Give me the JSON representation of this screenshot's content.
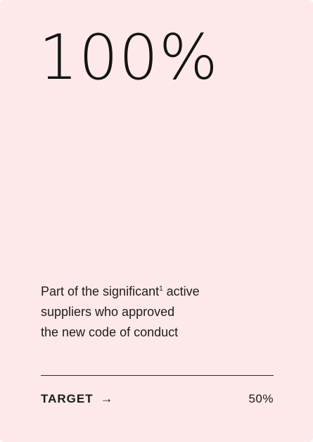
{
  "card": {
    "value": "100%",
    "description": {
      "line1_prefix": "Part of the significant",
      "footnote": "1",
      "line1_suffix": " active",
      "line2": "suppliers who approved",
      "line3": "the new code of conduct"
    },
    "footer": {
      "target_label": "TARGET",
      "arrow_icon": "arrow-right-icon",
      "arrow_glyph": "→",
      "target_value": "50%"
    },
    "colors": {
      "background": "#fde9ea",
      "text": "#1a1a1a"
    }
  }
}
